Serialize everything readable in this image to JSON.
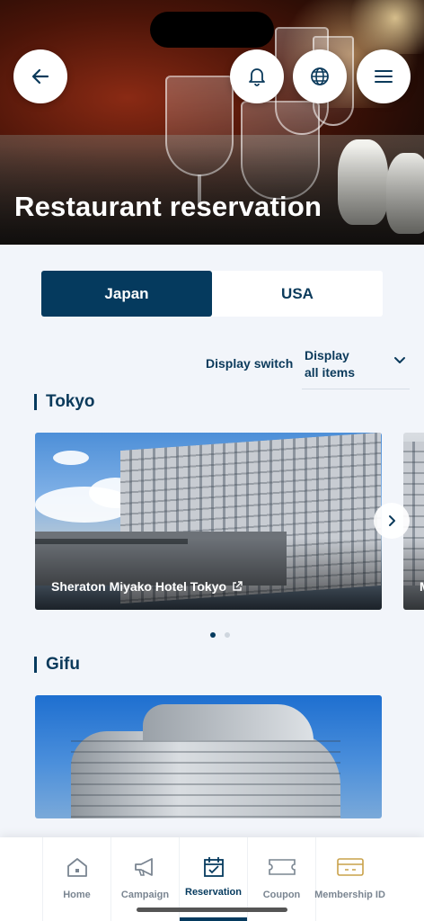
{
  "hero": {
    "title": "Restaurant reservation"
  },
  "header_buttons": {
    "back_icon": "arrow-left-icon",
    "bell_icon": "bell-icon",
    "globe_icon": "globe-icon",
    "menu_icon": "hamburger-menu-icon"
  },
  "region_tabs": [
    {
      "label": "Japan",
      "active": true
    },
    {
      "label": "USA",
      "active": false
    }
  ],
  "display_switch": {
    "label": "Display switch",
    "value_line1": "Display",
    "value_line2": "all items"
  },
  "sections": [
    {
      "title": "Tokyo",
      "cards": [
        {
          "name": "Sheraton Miyako Hotel Tokyo",
          "external_link": true
        },
        {
          "name": "M"
        }
      ],
      "carousel": {
        "page": 1,
        "pages": 2
      }
    },
    {
      "title": "Gifu",
      "cards": []
    }
  ],
  "bottom_nav": [
    {
      "label": "Home",
      "icon": "home-icon",
      "active": false
    },
    {
      "label": "Campaign",
      "icon": "megaphone-icon",
      "active": false
    },
    {
      "label": "Reservation",
      "icon": "calendar-check-icon",
      "active": true
    },
    {
      "label": "Coupon",
      "icon": "ticket-icon",
      "active": false
    },
    {
      "label": "Membership ID",
      "icon": "card-icon",
      "active": false
    }
  ],
  "colors": {
    "primary": "#053a5e",
    "background": "#f2f5fa",
    "membership_accent": "#c9a24a"
  }
}
